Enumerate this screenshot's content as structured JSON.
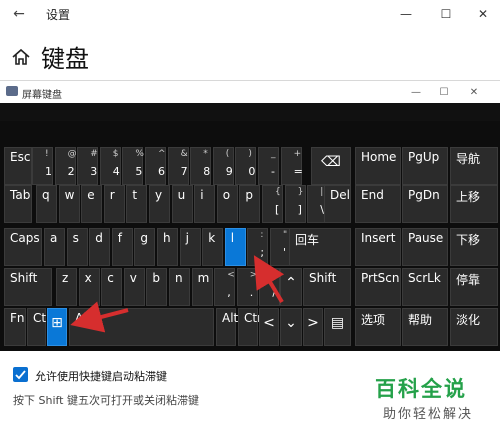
{
  "settings": {
    "window_title": "设置",
    "page_title": "键盘"
  },
  "osk": {
    "title": "屏幕键盘",
    "rows": {
      "r1": [
        {
          "id": "esc",
          "main": "Esc"
        },
        {
          "id": "k1",
          "shift": "!",
          "low": "1"
        },
        {
          "id": "k2",
          "shift": "@",
          "low": "2"
        },
        {
          "id": "k3",
          "shift": "#",
          "low": "3"
        },
        {
          "id": "k4",
          "shift": "$",
          "low": "4"
        },
        {
          "id": "k5",
          "shift": "%",
          "low": "5"
        },
        {
          "id": "k6",
          "shift": "^",
          "low": "6"
        },
        {
          "id": "k7",
          "shift": "&",
          "low": "7"
        },
        {
          "id": "k8",
          "shift": "*",
          "low": "8"
        },
        {
          "id": "k9",
          "shift": "(",
          "low": "9"
        },
        {
          "id": "k0",
          "shift": ")",
          "low": "0"
        },
        {
          "id": "kminus",
          "shift": "_",
          "low": "-"
        },
        {
          "id": "kequal",
          "shift": "+",
          "low": "="
        },
        {
          "id": "backspace",
          "main": "⌫"
        }
      ],
      "r2": [
        {
          "id": "tab",
          "main": "Tab"
        },
        {
          "id": "q",
          "main": "q"
        },
        {
          "id": "w",
          "main": "w"
        },
        {
          "id": "e",
          "main": "e"
        },
        {
          "id": "r",
          "main": "r"
        },
        {
          "id": "t",
          "main": "t"
        },
        {
          "id": "y",
          "main": "y"
        },
        {
          "id": "u",
          "main": "u"
        },
        {
          "id": "i",
          "main": "i"
        },
        {
          "id": "o",
          "main": "o"
        },
        {
          "id": "p",
          "main": "p"
        },
        {
          "id": "lbracket",
          "shift": "{",
          "low": "["
        },
        {
          "id": "rbracket",
          "shift": "}",
          "low": "]"
        },
        {
          "id": "backslash",
          "shift": "|",
          "low": "\\"
        },
        {
          "id": "del",
          "main": "Del"
        }
      ],
      "r3": [
        {
          "id": "caps",
          "main": "Caps"
        },
        {
          "id": "a",
          "main": "a"
        },
        {
          "id": "s",
          "main": "s"
        },
        {
          "id": "d",
          "main": "d"
        },
        {
          "id": "f",
          "main": "f"
        },
        {
          "id": "g",
          "main": "g"
        },
        {
          "id": "h",
          "main": "h"
        },
        {
          "id": "j",
          "main": "j"
        },
        {
          "id": "k",
          "main": "k"
        },
        {
          "id": "l",
          "main": "l"
        },
        {
          "id": "semicolon",
          "shift": ":",
          "low": ";"
        },
        {
          "id": "quote",
          "shift": "\"",
          "low": "'"
        },
        {
          "id": "enter",
          "main": "回车"
        }
      ],
      "r4": [
        {
          "id": "lshift",
          "main": "Shift"
        },
        {
          "id": "z",
          "main": "z"
        },
        {
          "id": "x",
          "main": "x"
        },
        {
          "id": "c",
          "main": "c"
        },
        {
          "id": "v",
          "main": "v"
        },
        {
          "id": "b",
          "main": "b"
        },
        {
          "id": "n",
          "main": "n"
        },
        {
          "id": "m",
          "main": "m"
        },
        {
          "id": "comma",
          "shift": "<",
          "low": ","
        },
        {
          "id": "period",
          "shift": ">",
          "low": "."
        },
        {
          "id": "slash",
          "shift": "?",
          "low": "/"
        },
        {
          "id": "up",
          "main": "⌃"
        },
        {
          "id": "rshift",
          "main": "Shift"
        }
      ],
      "r5": [
        {
          "id": "fn",
          "main": "Fn"
        },
        {
          "id": "ctrl",
          "main": "Ctrl"
        },
        {
          "id": "win",
          "main": "⊞"
        },
        {
          "id": "alt",
          "main": "Alt"
        },
        {
          "id": "altr",
          "main": "Alt"
        },
        {
          "id": "ctrlr",
          "main": "Ctrl"
        },
        {
          "id": "left",
          "main": "<"
        },
        {
          "id": "down",
          "main": "⌄"
        },
        {
          "id": "right",
          "main": ">"
        },
        {
          "id": "menu",
          "main": "▤"
        }
      ],
      "nav": [
        {
          "id": "home",
          "main": "Home"
        },
        {
          "id": "pgup",
          "main": "PgUp"
        },
        {
          "id": "navkey",
          "main": "导航"
        },
        {
          "id": "end",
          "main": "End"
        },
        {
          "id": "pgdn",
          "main": "PgDn"
        },
        {
          "id": "shangyi",
          "main": "上移"
        },
        {
          "id": "insert",
          "main": "Insert"
        },
        {
          "id": "pause",
          "main": "Pause"
        },
        {
          "id": "xiayi",
          "main": "下移"
        },
        {
          "id": "prtscn",
          "main": "PrtScn"
        },
        {
          "id": "scrlk",
          "main": "ScrLk"
        },
        {
          "id": "tingkao",
          "main": "停靠"
        },
        {
          "id": "options",
          "main": "选项"
        },
        {
          "id": "help",
          "main": "帮助"
        },
        {
          "id": "fade",
          "main": "淡化"
        }
      ]
    }
  },
  "sticky_keys": {
    "checkbox_label": "允许使用快捷键启动粘滞键",
    "checked": true,
    "hint": "按下 Shift 键五次可打开或关闭粘滞键"
  },
  "watermark": {
    "line1": "百科全说",
    "line2": "助你轻松解决",
    "color": "#25a14a"
  },
  "colors": {
    "key_bg": "#2b2b2b",
    "key_highlight": "#0a78d7",
    "arrow": "#d62e2e"
  }
}
